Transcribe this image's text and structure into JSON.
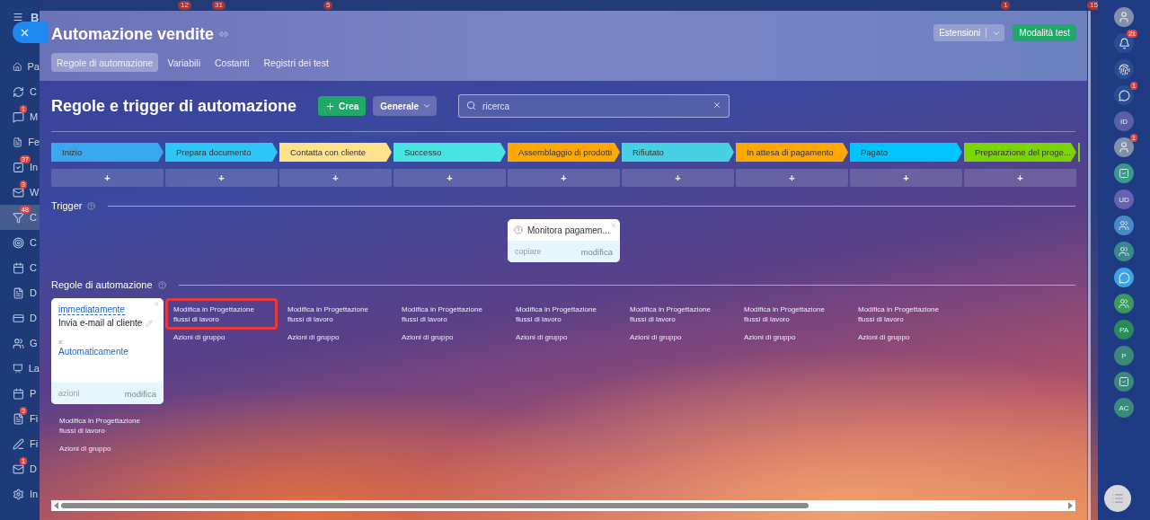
{
  "top_badges": [
    "12",
    "31",
    "5",
    "1",
    "15"
  ],
  "left_nav": {
    "title": "B",
    "items": [
      {
        "label": "Pa",
        "selected": false
      },
      {
        "label": "C",
        "selected": false
      },
      {
        "label": "M",
        "badge": "1",
        "selected": false
      },
      {
        "label": "Fe",
        "selected": false
      },
      {
        "label": "In",
        "badge": "37",
        "selected": false
      },
      {
        "label": "W",
        "badge": "3",
        "selected": false
      },
      {
        "label": "C",
        "badge": "48",
        "selected": true
      },
      {
        "label": "C",
        "selected": false
      },
      {
        "label": "C",
        "selected": false
      },
      {
        "label": "D",
        "selected": false
      },
      {
        "label": "D",
        "selected": false
      },
      {
        "label": "G",
        "selected": false
      },
      {
        "label": "La",
        "selected": false
      },
      {
        "label": "P",
        "selected": false
      },
      {
        "label": "Fi",
        "badge": "3",
        "selected": false
      },
      {
        "label": "Fi",
        "selected": false
      },
      {
        "label": "D",
        "badge": "1",
        "selected": false
      },
      {
        "label": "In",
        "selected": false
      }
    ]
  },
  "slider": {
    "title": "Automazione vendite",
    "tabs": [
      {
        "label": "Regole di automazione",
        "selected": true
      },
      {
        "label": "Variabili",
        "selected": false
      },
      {
        "label": "Costanti",
        "selected": false
      },
      {
        "label": "Registri dei test",
        "selected": false
      }
    ],
    "extensions": "Estensioni",
    "test_mode": "Modalità test",
    "heading": "Regole e trigger di automazione",
    "create": "Crea",
    "filter": "Generale",
    "search": {
      "placeholder": "ricerca"
    },
    "trigger_title": "Trigger",
    "rules_title": "Regole di automazione",
    "stages": [
      {
        "kind": "stage",
        "name": "Inizio",
        "color": "#39a8ef",
        "add": "+",
        "rule_card": {
          "delay": "immediatamente",
          "title": "Invia e-mail al cliente",
          "to_label": "a:",
          "to": "Automaticamente",
          "actions": "azioni",
          "edit": "modifica"
        },
        "designer_link": "Modifica in Progettazione flussi di lavoro",
        "group_actions": "Azioni di gruppo"
      },
      {
        "kind": "stage",
        "name": "Prepara documento",
        "color": "#2fc6f6",
        "add": "+",
        "designer_link": "Modifica in Progettazione flussi di lavoro",
        "group_actions": "Azioni di gruppo",
        "highlighted": true
      },
      {
        "kind": "stage",
        "name": "Contatta con cliente",
        "color": "#ffe28a",
        "add": "+",
        "designer_link": "Modifica in Progettazione flussi di lavoro",
        "group_actions": "Azioni di gruppo"
      },
      {
        "kind": "stage",
        "name": "Successo",
        "color": "#47e4e2",
        "add": "+",
        "designer_link": "Modifica in Progettazione flussi di lavoro",
        "group_actions": "Azioni di gruppo"
      },
      {
        "kind": "stage",
        "name": "Assemblaggio di prodotti",
        "color": "#ffa900",
        "add": "+",
        "trigger": {
          "title": "Monitora pagamen...",
          "copy": "copiare",
          "edit": "modifica"
        },
        "designer_link": "Modifica in Progettazione flussi di lavoro",
        "group_actions": "Azioni di gruppo"
      },
      {
        "kind": "stage",
        "name": "Rifiutato",
        "color": "#47d1e2",
        "add": "+",
        "designer_link": "Modifica in Progettazione flussi di lavoro",
        "group_actions": "Azioni di gruppo"
      },
      {
        "kind": "stage",
        "name": "In attesa di pagamento",
        "color": "#ffa900",
        "add": "+",
        "designer_link": "Modifica in Progettazione flussi di lavoro",
        "group_actions": "Azioni di gruppo"
      },
      {
        "kind": "stage",
        "name": "Pagato",
        "color": "#00c4fb",
        "add": "+",
        "designer_link": "Modifica in Progettazione flussi di lavoro",
        "group_actions": "Azioni di gruppo"
      },
      {
        "kind": "stage",
        "name": "Preparazione del proge...",
        "color": "#7bd500",
        "add": "+"
      },
      {
        "kind": "stub",
        "color": "#7bd500"
      }
    ]
  },
  "right_bar": [
    {
      "kind": "avatar"
    },
    {
      "kind": "bell",
      "badge": "21"
    },
    {
      "kind": "spiral"
    },
    {
      "kind": "chat",
      "badge": "1"
    },
    {
      "kind": "initials",
      "text": "ID",
      "color": "#5a5fa8"
    },
    {
      "kind": "avatar",
      "badge": "1"
    },
    {
      "kind": "task",
      "color": "#3a9a8a"
    },
    {
      "kind": "initials",
      "text": "UD",
      "color": "#6a5fb0"
    },
    {
      "kind": "group",
      "color": "#4a8ac8"
    },
    {
      "kind": "group",
      "color": "#3a8a8a"
    },
    {
      "kind": "chat",
      "color": "#3ba4e8"
    },
    {
      "kind": "group",
      "color": "#3a9a5a"
    },
    {
      "kind": "initials",
      "text": "PA",
      "color": "#2a8a5a"
    },
    {
      "kind": "initials",
      "text": "P",
      "color": "#3a8a7a"
    },
    {
      "kind": "task",
      "color": "#3a8a7a"
    },
    {
      "kind": "initials",
      "text": "AC",
      "color": "#3a8a7a"
    }
  ]
}
